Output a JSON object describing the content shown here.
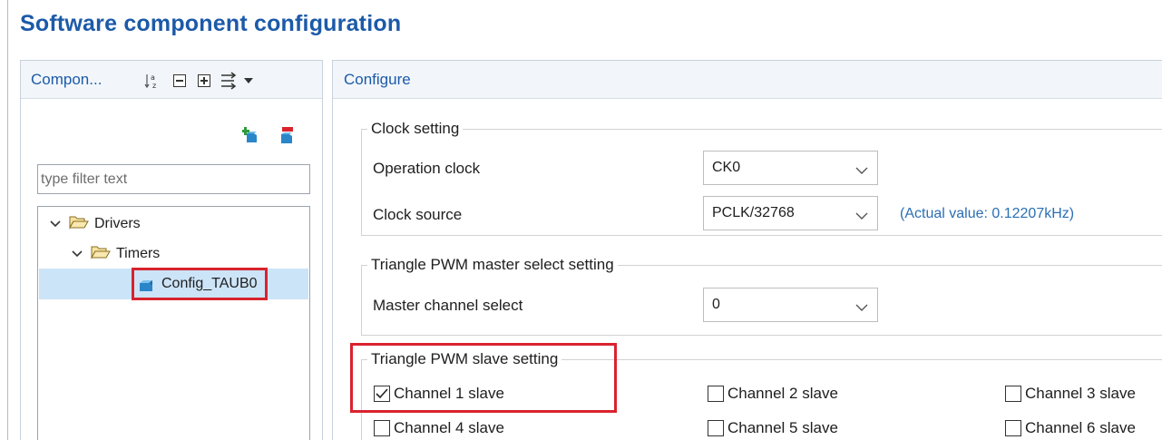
{
  "page": {
    "title": "Software component configuration"
  },
  "left_panel": {
    "tab_label": "Compon...",
    "toolbar_icons": [
      "sort-alpha-icon",
      "collapse-all-icon",
      "expand-all-icon",
      "filter-toggle-icon",
      "view-menu-chevron-icon"
    ],
    "actions": [
      "add-component-icon",
      "remove-component-icon"
    ],
    "filter": {
      "placeholder": "type filter text",
      "value": ""
    },
    "tree": [
      {
        "label": "Drivers",
        "expanded": true,
        "level": 0
      },
      {
        "label": "Timers",
        "expanded": true,
        "level": 1
      },
      {
        "label": "Config_TAUB0",
        "selected": true,
        "level": 2
      }
    ]
  },
  "right_panel": {
    "tab_label": "Configure",
    "clock_setting": {
      "legend": "Clock setting",
      "operation_clock": {
        "label": "Operation clock",
        "value": "CK0"
      },
      "clock_source": {
        "label": "Clock source",
        "value": "PCLK/32768",
        "actual_value": "(Actual value: 0.12207kHz)"
      }
    },
    "master_select": {
      "legend": "Triangle PWM master select setting",
      "master_channel": {
        "label": "Master channel select",
        "value": "0"
      }
    },
    "slave_setting": {
      "legend": "Triangle PWM slave setting",
      "channels": [
        {
          "label": "Channel 1 slave",
          "checked": true
        },
        {
          "label": "Channel 2 slave",
          "checked": false
        },
        {
          "label": "Channel 3 slave",
          "checked": false
        },
        {
          "label": "Channel 4 slave",
          "checked": false
        },
        {
          "label": "Channel 5 slave",
          "checked": false
        },
        {
          "label": "Channel 6 slave",
          "checked": false
        }
      ]
    }
  },
  "colors": {
    "title_blue": "#1c5aa8",
    "highlight_red": "#d9232e",
    "actual_value_blue": "#2a6fb3",
    "tree_selection": "#cce4f7"
  }
}
